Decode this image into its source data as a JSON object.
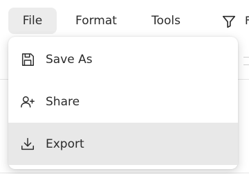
{
  "menubar": {
    "tabs": [
      {
        "label": "File",
        "active": true
      },
      {
        "label": "Format",
        "active": false
      },
      {
        "label": "Tools",
        "active": false
      }
    ],
    "filter_icon": "filter-icon",
    "truncated_label": "F"
  },
  "dropdown": {
    "items": [
      {
        "label": "Save As",
        "icon": "save-icon",
        "highlighted": false
      },
      {
        "label": "Share",
        "icon": "add-person-icon",
        "highlighted": false
      },
      {
        "label": "Export",
        "icon": "download-icon",
        "highlighted": true
      }
    ]
  },
  "colors": {
    "active_tab_bg": "#ececec",
    "highlight_bg": "#e8e8e8",
    "text": "#2b2b2b",
    "icon_stroke": "#2b2b2b"
  }
}
